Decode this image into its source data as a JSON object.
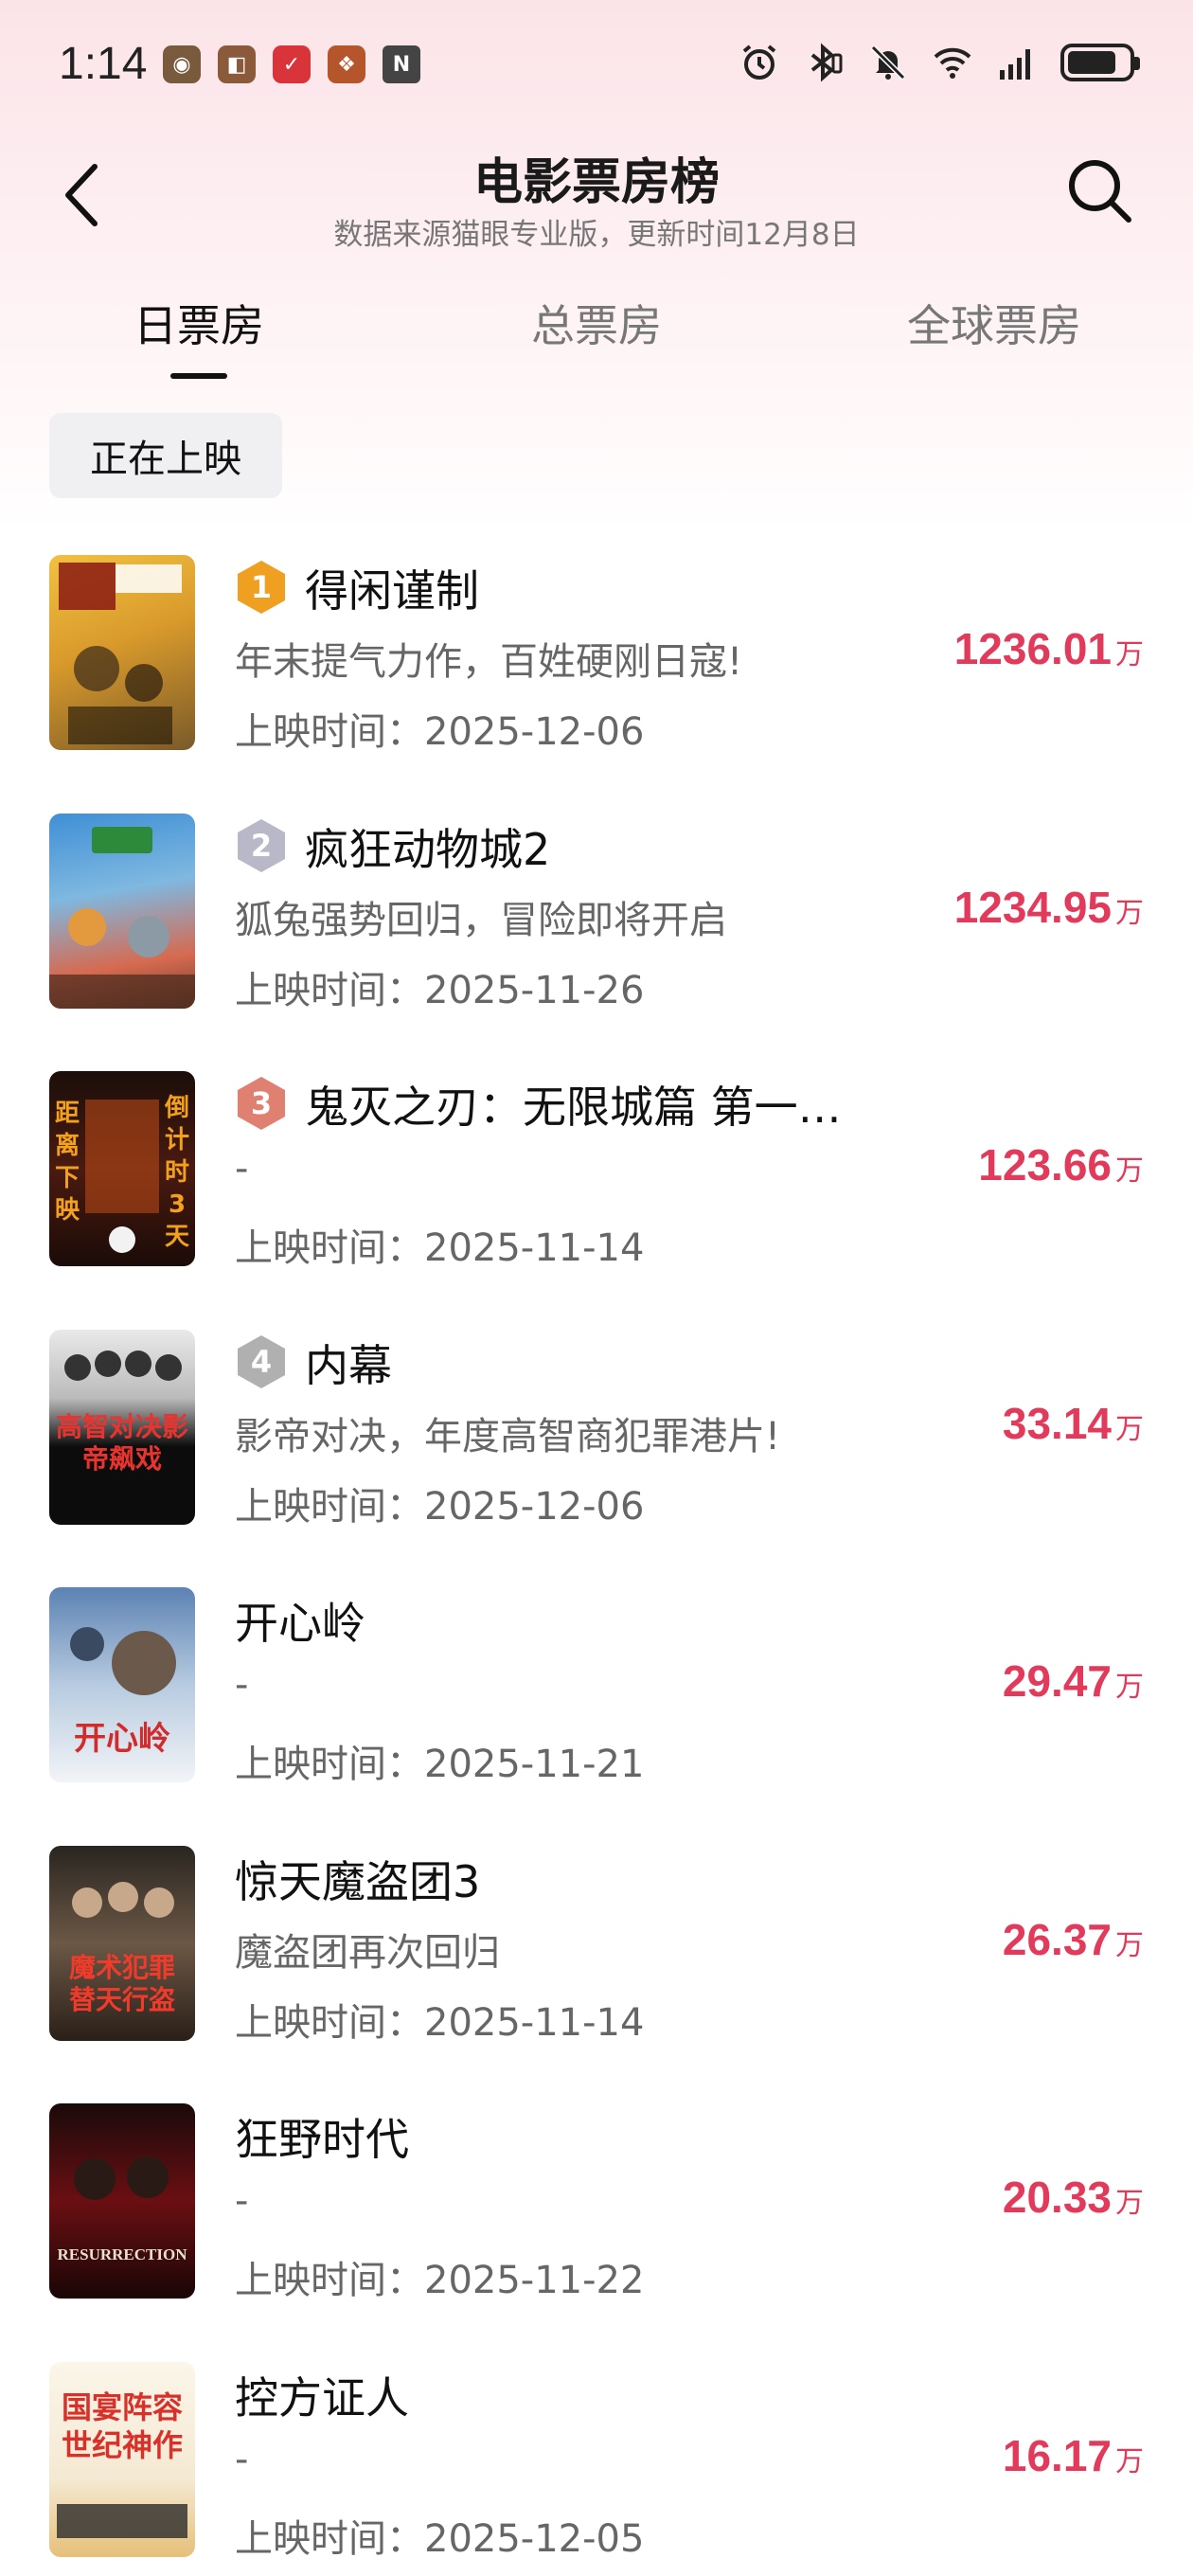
{
  "status_bar": {
    "time": "1:14"
  },
  "header": {
    "title": "电影票房榜",
    "subtitle": "数据来源猫眼专业版，更新时间12月8日"
  },
  "tabs": [
    {
      "label": "日票房",
      "active": true
    },
    {
      "label": "总票房",
      "active": false
    },
    {
      "label": "全球票房",
      "active": false
    }
  ],
  "filter": {
    "label": "正在上映"
  },
  "movies": [
    {
      "rank": "1",
      "title": "得闲谨制",
      "tagline": "年末提气力作，百姓硬刚日寇!",
      "date": "上映时间：2025-12-06",
      "box_value": "1236.01",
      "unit": "万",
      "badge_color": "#f0a020"
    },
    {
      "rank": "2",
      "title": "疯狂动物城2",
      "tagline": "狐兔强势回归，冒险即将开启",
      "date": "上映时间：2025-11-26",
      "box_value": "1234.95",
      "unit": "万",
      "badge_color": "#b8b8c8"
    },
    {
      "rank": "3",
      "title": "鬼灭之刃：无限城篇 第一…",
      "tagline": "-",
      "date": "上映时间：2025-11-14",
      "box_value": "123.66",
      "unit": "万",
      "badge_color": "#e08070"
    },
    {
      "rank": "4",
      "title": "内幕",
      "tagline": "影帝对决，年度高智商犯罪港片!",
      "date": "上映时间：2025-12-06",
      "box_value": "33.14",
      "unit": "万",
      "badge_color": "#b0b0b0"
    },
    {
      "rank": "",
      "title": "开心岭",
      "tagline": "-",
      "date": "上映时间：2025-11-21",
      "box_value": "29.47",
      "unit": "万",
      "badge_color": ""
    },
    {
      "rank": "",
      "title": "惊天魔盗团3",
      "tagline": "魔盗团再次回归",
      "date": "上映时间：2025-11-14",
      "box_value": "26.37",
      "unit": "万",
      "badge_color": ""
    },
    {
      "rank": "",
      "title": "狂野时代",
      "tagline": "-",
      "date": "上映时间：2025-11-22",
      "box_value": "20.33",
      "unit": "万",
      "badge_color": ""
    },
    {
      "rank": "",
      "title": "控方证人",
      "tagline": "-",
      "date": "上映时间：2025-12-05",
      "box_value": "16.17",
      "unit": "万",
      "badge_color": ""
    }
  ],
  "posters": {
    "p3_left": "距离下映",
    "p3_right": "倒计时3天",
    "p4_text": "高智对决影帝飙戏",
    "p5_text": "开心岭",
    "p6_text": "魔术犯罪替天行盗",
    "p7_text": "RESURRECTION",
    "p8_text": "国宴阵容世纪神作"
  },
  "icons": {
    "back": "chevron-left-icon",
    "search": "search-icon",
    "alarm": "alarm-icon",
    "bluetooth": "bluetooth-icon",
    "mute": "bell-off-icon",
    "wifi": "wifi-icon",
    "signal": "signal-icon",
    "battery": "battery-icon"
  },
  "colors": {
    "accent": "#e23a5a",
    "gold": "#f0a020",
    "silver": "#b8b8c8",
    "bronze": "#e08070"
  },
  "battery_level": 0.8
}
